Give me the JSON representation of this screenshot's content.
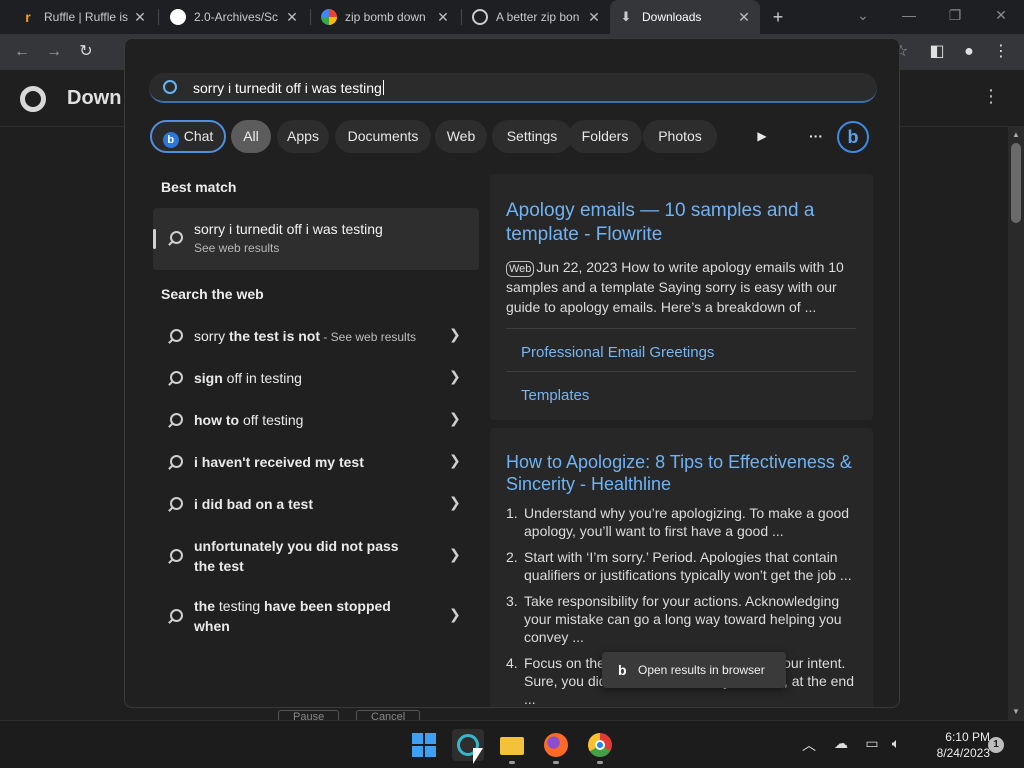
{
  "browser": {
    "tabs": [
      {
        "title": "Ruffle | Ruffle is",
        "favicon": "ruffle-icon",
        "color": "#f59a23"
      },
      {
        "title": "2.0-Archives/Sc",
        "favicon": "github-icon",
        "color": "#ffffff"
      },
      {
        "title": "zip bomb down",
        "favicon": "google-icon",
        "color": "#4285f4"
      },
      {
        "title": "A better zip bon",
        "favicon": "globe-icon",
        "color": "#cccccc"
      },
      {
        "title": "Downloads",
        "favicon": "download-icon",
        "color": "#cccccc"
      }
    ],
    "new_tab": "+",
    "page_title": "Down"
  },
  "search": {
    "query": "sorry i turnedit off i was testing",
    "filters": [
      {
        "label": "Chat"
      },
      {
        "label": "All"
      },
      {
        "label": "Apps"
      },
      {
        "label": "Documents"
      },
      {
        "label": "Web"
      },
      {
        "label": "Settings"
      },
      {
        "label": "Folders"
      },
      {
        "label": "Photos"
      }
    ],
    "more": "···",
    "play": "▶",
    "bing_glyph": "b"
  },
  "best_match": {
    "heading": "Best match",
    "title": "sorry i turnedit off i was testing",
    "subtitle": "See web results"
  },
  "web": {
    "heading": "Search the web",
    "suggestions": [
      {
        "pre": "sorry ",
        "bold": "the test is not",
        "post": "",
        "suffix": " - See web results"
      },
      {
        "pre": "",
        "bold": "sign",
        "post": " off in testing",
        "suffix": ""
      },
      {
        "pre": "",
        "bold": "how to",
        "post": " off testing",
        "suffix": ""
      },
      {
        "pre": "",
        "bold": "i haven't received my test",
        "post": "",
        "suffix": ""
      },
      {
        "pre": "",
        "bold": "i did bad on a test",
        "post": "",
        "suffix": ""
      },
      {
        "pre": "",
        "bold": "unfortunately you did not pass the test",
        "post": "",
        "suffix": ""
      },
      {
        "pre": "",
        "bold": "the",
        "post": " testing ",
        "bold2": "have been stopped when",
        "suffix": ""
      }
    ]
  },
  "results": {
    "card1": {
      "title": "Apology emails — 10 samples and a template - Flowrite",
      "badge": "Web",
      "snippet": "Jun 22, 2023 How to write apology emails with 10 samples and a template Saying sorry is easy with our guide to apology emails. Here’s a breakdown of ...",
      "links": [
        "Professional Email Greetings",
        "Templates"
      ]
    },
    "card2": {
      "title": "How to Apologize: 8 Tips to Effectiveness & Sincerity - Healthline",
      "items": [
        {
          "n": "1.",
          "text": "Understand why you’re apologizing. To make a good apology, you’ll want to first have a good ..."
        },
        {
          "n": "2.",
          "text": "Start with ‘I’m sorry.’ Period. Apologies that contain qualifiers or justifications typically won’t get the job ..."
        },
        {
          "n": "3.",
          "text": "Take responsibility for your actions. Acknowledging your mistake can go a long way toward helping you convey ..."
        },
        {
          "n": "4.",
          "text": "Focus on the impact of your actions, not your intent. Sure, you didn’t mean to hurt anyone. Still, at the end ..."
        }
      ]
    },
    "open_in_browser": "Open results in browser"
  },
  "background_buttons": [
    "Pause",
    "Cancel"
  ],
  "taskbar": {
    "time": "6:10 PM",
    "date": "8/24/2023",
    "notifications": "1"
  }
}
